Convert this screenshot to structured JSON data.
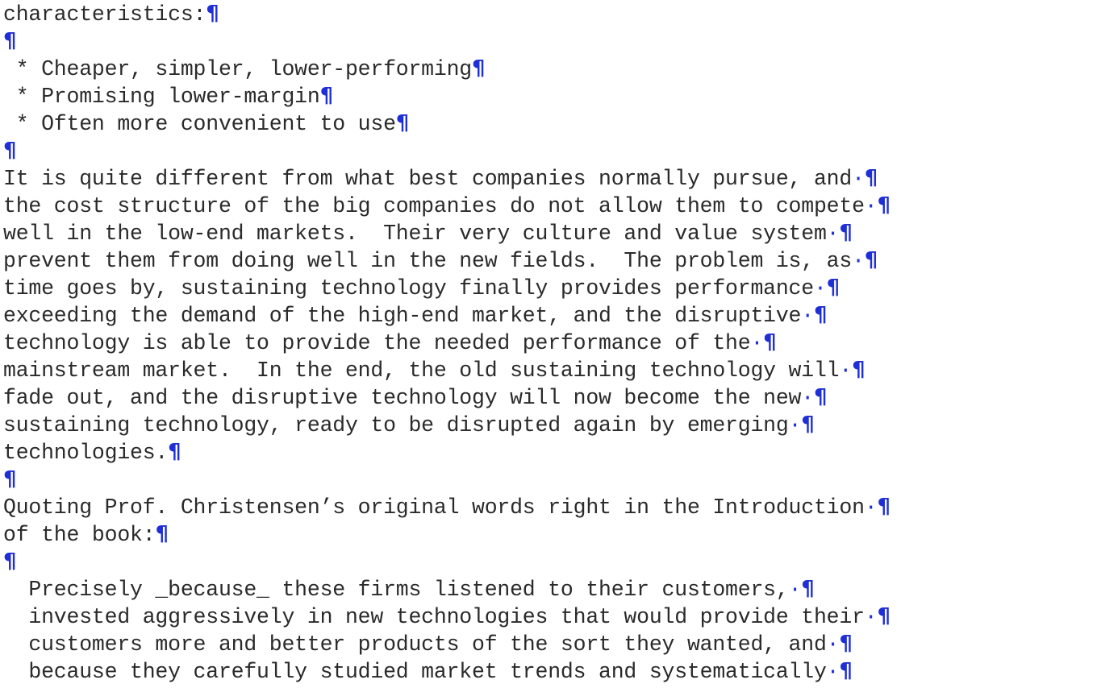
{
  "marks": {
    "space_dot": "·",
    "pilcrow": "¶"
  },
  "colors": {
    "text": "#2a2a2a",
    "formatting_marks": "#1f2fd6",
    "background": "#ffffff"
  },
  "lines": [
    {
      "text": "characteristics:",
      "dot": false
    },
    {
      "text": "",
      "dot": false
    },
    {
      "text": " * Cheaper, simpler, lower-performing",
      "dot": false
    },
    {
      "text": " * Promising lower-margin",
      "dot": false
    },
    {
      "text": " * Often more convenient to use",
      "dot": false
    },
    {
      "text": "",
      "dot": false
    },
    {
      "text": "It is quite different from what best companies normally pursue, and",
      "dot": true
    },
    {
      "text": "the cost structure of the big companies do not allow them to compete",
      "dot": true
    },
    {
      "text": "well in the low-end markets.  Their very culture and value system",
      "dot": true
    },
    {
      "text": "prevent them from doing well in the new fields.  The problem is, as",
      "dot": true
    },
    {
      "text": "time goes by, sustaining technology finally provides performance",
      "dot": true
    },
    {
      "text": "exceeding the demand of the high-end market, and the disruptive",
      "dot": true
    },
    {
      "text": "technology is able to provide the needed performance of the",
      "dot": true
    },
    {
      "text": "mainstream market.  In the end, the old sustaining technology will",
      "dot": true
    },
    {
      "text": "fade out, and the disruptive technology will now become the new",
      "dot": true
    },
    {
      "text": "sustaining technology, ready to be disrupted again by emerging",
      "dot": true
    },
    {
      "text": "technologies.",
      "dot": false
    },
    {
      "text": "",
      "dot": false
    },
    {
      "text": "Quoting Prof. Christensen’s original words right in the Introduction",
      "dot": true
    },
    {
      "text": "of the book:",
      "dot": false
    },
    {
      "text": "",
      "dot": false
    },
    {
      "text": "  Precisely _because_ these firms listened to their customers,",
      "dot": true
    },
    {
      "text": "  invested aggressively in new technologies that would provide their",
      "dot": true
    },
    {
      "text": "  customers more and better products of the sort they wanted, and",
      "dot": true
    },
    {
      "text": "  because they carefully studied market trends and systematically",
      "dot": true
    }
  ]
}
